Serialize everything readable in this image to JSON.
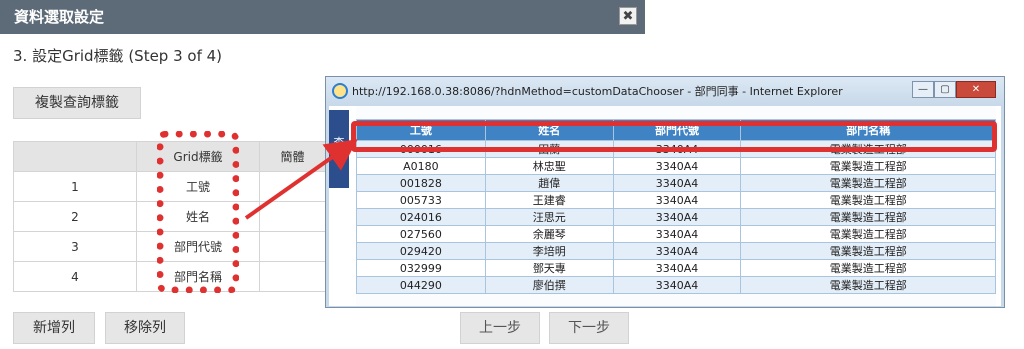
{
  "dialog": {
    "title": "資料選取設定",
    "close_glyph": "✖",
    "step_text": "3. 設定Grid標籤  (Step 3 of 4)",
    "copy_button": "複製查詢標籤",
    "table": {
      "headers": [
        "",
        "Grid標籤",
        "簡體"
      ],
      "rows": [
        {
          "num": "1",
          "label": "工號"
        },
        {
          "num": "2",
          "label": "姓名"
        },
        {
          "num": "3",
          "label": "部門代號"
        },
        {
          "num": "4",
          "label": "部門名稱"
        }
      ]
    },
    "add_row_button": "新增列",
    "remove_row_button": "移除列",
    "prev_button": "上一步",
    "next_button": "下一步"
  },
  "popup": {
    "title": "http://192.168.0.38:8086/?hdnMethod=customDataChooser - 部門同事 - Internet Explorer",
    "side_tab": "查",
    "min_glyph": "—",
    "max_glyph": "▢",
    "close_glyph": "✕",
    "grid": {
      "headers": [
        "工號",
        "姓名",
        "部門代號",
        "部門名稱"
      ],
      "rows": [
        [
          "000016",
          "田蘭",
          "3340A4",
          "電業製造工程部"
        ],
        [
          "A0180",
          "林忠聖",
          "3340A4",
          "電業製造工程部"
        ],
        [
          "001828",
          "趙偉",
          "3340A4",
          "電業製造工程部"
        ],
        [
          "005733",
          "王建睿",
          "3340A4",
          "電業製造工程部"
        ],
        [
          "024016",
          "汪思元",
          "3340A4",
          "電業製造工程部"
        ],
        [
          "027560",
          "余麗琴",
          "3340A4",
          "電業製造工程部"
        ],
        [
          "029420",
          "李培明",
          "3340A4",
          "電業製造工程部"
        ],
        [
          "032999",
          "鄧天專",
          "3340A4",
          "電業製造工程部"
        ],
        [
          "044290",
          "廖伯撰",
          "3340A4",
          "電業製造工程部"
        ]
      ]
    }
  },
  "colors": {
    "title_bar": "#5d6a77",
    "grid_header": "#3f83c4",
    "highlight": "#e03131"
  }
}
